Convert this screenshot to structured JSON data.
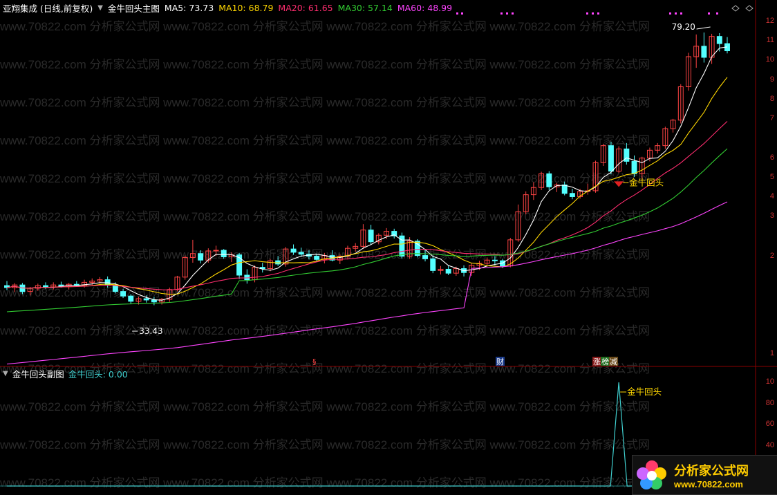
{
  "main_header": {
    "title": "亚翔集成 (日线,前复权)",
    "indicator_name": "金牛回头主图",
    "ma5": "MA5: 73.73",
    "ma10": "MA10: 68.79",
    "ma20": "MA20: 61.65",
    "ma30": "MA30: 57.14",
    "ma60": "MA60: 48.99"
  },
  "sub_header": {
    "title": "金牛回头副图",
    "value": "金牛回头: 0.00"
  },
  "annotations": {
    "high_price": "79.20",
    "low_price": "33.43",
    "signal_label": "金牛回头",
    "sub_signal_label": "金牛回头",
    "event_s": "§",
    "event_cai": "财",
    "event_zhang": "涨",
    "event_bang": "榜",
    "event_jian": "减"
  },
  "watermark": {
    "text": "www.70822.com 分析家公式网"
  },
  "logo": {
    "name": "分析家公式网",
    "url": "www.70822.com"
  },
  "main_axis": [
    "12",
    "11",
    "10",
    "9",
    "8",
    "7",
    "6",
    "5",
    "4",
    "3",
    "2",
    "1"
  ],
  "sub_axis": [
    "10",
    "80",
    "60",
    "40"
  ],
  "colors": {
    "up": "#ff4444",
    "down": "#54ffff",
    "ma5": "#ffffff",
    "ma10": "#ffd700",
    "ma20": "#ff2d6f",
    "ma30": "#32cd32",
    "ma60": "#ff44ff",
    "title_white": "#ffffff",
    "sub_value": "#40d0d0"
  },
  "chart_data": {
    "type": "candlestick",
    "series": [
      {
        "name": "K线",
        "ohlc": [
          [
            40.5,
            41.2,
            39.8,
            40.2
          ],
          [
            40.2,
            40.9,
            39.5,
            40.6
          ],
          [
            40.6,
            40.9,
            39.2,
            39.6
          ],
          [
            39.6,
            40.3,
            39.0,
            40.1
          ],
          [
            40.1,
            40.8,
            39.7,
            40.5
          ],
          [
            40.5,
            41.0,
            40.0,
            40.3
          ],
          [
            40.3,
            41.0,
            39.9,
            40.6
          ],
          [
            40.6,
            41.1,
            40.2,
            40.4
          ],
          [
            40.4,
            40.9,
            39.9,
            40.7
          ],
          [
            40.7,
            41.2,
            40.3,
            40.5
          ],
          [
            40.5,
            41.4,
            40.2,
            41.0
          ],
          [
            41.0,
            41.6,
            40.6,
            41.2
          ],
          [
            41.2,
            41.8,
            40.8,
            41.4
          ],
          [
            41.4,
            41.9,
            40.2,
            40.6
          ],
          [
            40.6,
            41.0,
            39.3,
            39.6
          ],
          [
            39.6,
            40.0,
            38.6,
            38.9
          ],
          [
            38.9,
            39.2,
            37.7,
            38.1
          ],
          [
            38.1,
            38.8,
            37.6,
            38.5
          ],
          [
            38.5,
            39.0,
            37.9,
            38.3
          ],
          [
            38.3,
            38.8,
            37.5,
            38.0
          ],
          [
            38.0,
            38.6,
            37.6,
            38.4
          ],
          [
            38.4,
            40.2,
            38.0,
            39.9
          ],
          [
            39.9,
            42.0,
            39.6,
            41.8
          ],
          [
            41.8,
            45.1,
            41.4,
            44.8
          ],
          [
            44.8,
            47.5,
            44.0,
            45.4
          ],
          [
            45.4,
            45.9,
            43.9,
            44.4
          ],
          [
            44.4,
            46.2,
            44.0,
            45.8
          ],
          [
            45.8,
            46.6,
            45.0,
            45.9
          ],
          [
            45.9,
            46.1,
            44.6,
            44.9
          ],
          [
            44.9,
            45.6,
            44.1,
            45.2
          ],
          [
            45.2,
            45.5,
            41.5,
            42.1
          ],
          [
            42.1,
            43.0,
            40.8,
            41.4
          ],
          [
            41.4,
            43.6,
            41.0,
            43.3
          ],
          [
            43.3,
            44.0,
            42.5,
            43.1
          ],
          [
            43.1,
            44.6,
            42.7,
            44.3
          ],
          [
            44.3,
            45.0,
            43.5,
            43.8
          ],
          [
            43.8,
            46.4,
            43.4,
            46.1
          ],
          [
            46.1,
            46.8,
            45.2,
            45.6
          ],
          [
            45.6,
            46.3,
            44.9,
            45.3
          ],
          [
            45.3,
            45.9,
            44.5,
            45.0
          ],
          [
            45.0,
            45.4,
            44.1,
            44.5
          ],
          [
            44.5,
            45.5,
            43.9,
            45.1
          ],
          [
            45.1,
            45.9,
            44.2,
            44.4
          ],
          [
            44.4,
            45.3,
            43.8,
            45.0
          ],
          [
            45.0,
            46.6,
            44.5,
            46.2
          ],
          [
            46.2,
            47.0,
            45.7,
            46.5
          ],
          [
            46.5,
            49.9,
            46.1,
            49.0
          ],
          [
            49.0,
            49.8,
            46.7,
            47.2
          ],
          [
            47.2,
            48.5,
            46.8,
            48.2
          ],
          [
            48.2,
            49.3,
            47.6,
            48.8
          ],
          [
            48.8,
            49.2,
            47.7,
            48.1
          ],
          [
            48.1,
            48.6,
            44.6,
            45.0
          ],
          [
            45.0,
            47.9,
            44.6,
            47.3
          ],
          [
            47.3,
            47.6,
            44.8,
            45.1
          ],
          [
            45.1,
            46.0,
            44.2,
            44.6
          ],
          [
            44.6,
            45.1,
            42.4,
            42.8
          ],
          [
            42.8,
            43.5,
            42.2,
            43.0
          ],
          [
            43.0,
            43.6,
            42.1,
            42.4
          ],
          [
            42.4,
            43.4,
            42.0,
            43.1
          ],
          [
            43.1,
            43.6,
            41.9,
            42.5
          ],
          [
            42.5,
            43.9,
            42.0,
            43.6
          ],
          [
            43.6,
            44.3,
            42.9,
            43.9
          ],
          [
            43.9,
            44.8,
            43.4,
            44.4
          ],
          [
            44.4,
            45.0,
            43.6,
            44.3
          ],
          [
            44.3,
            44.6,
            43.2,
            43.5
          ],
          [
            43.5,
            47.8,
            43.3,
            47.5
          ],
          [
            47.5,
            52.9,
            47.2,
            51.8
          ],
          [
            51.8,
            54.9,
            51.4,
            54.4
          ],
          [
            54.4,
            56.3,
            53.6,
            55.5
          ],
          [
            55.5,
            57.9,
            55.1,
            57.6
          ],
          [
            57.6,
            58.0,
            55.1,
            55.6
          ],
          [
            55.6,
            56.2,
            54.8,
            55.9
          ],
          [
            55.9,
            56.4,
            54.3,
            54.6
          ],
          [
            54.6,
            55.3,
            53.7,
            54.1
          ],
          [
            54.1,
            55.3,
            53.8,
            54.9
          ],
          [
            54.9,
            56.1,
            54.4,
            55.0
          ],
          [
            55.0,
            59.6,
            54.7,
            59.3
          ],
          [
            59.3,
            62.2,
            58.8,
            61.9
          ],
          [
            61.9,
            62.5,
            57.5,
            58.0
          ],
          [
            58.0,
            61.8,
            57.7,
            61.4
          ],
          [
            61.4,
            62.3,
            59.0,
            59.5
          ],
          [
            59.5,
            60.4,
            57.1,
            57.6
          ],
          [
            57.6,
            60.2,
            56.7,
            60.0
          ],
          [
            60.0,
            61.6,
            59.5,
            61.2
          ],
          [
            61.2,
            62.3,
            60.7,
            61.9
          ],
          [
            61.9,
            64.8,
            61.4,
            64.5
          ],
          [
            64.5,
            66.0,
            63.9,
            65.8
          ],
          [
            65.8,
            71.3,
            65.3,
            70.9
          ],
          [
            70.9,
            76.1,
            70.3,
            75.5
          ],
          [
            75.5,
            78.9,
            73.8,
            77.1
          ],
          [
            77.1,
            79.2,
            74.6,
            75.4
          ],
          [
            75.4,
            79.0,
            74.4,
            78.6
          ],
          [
            78.6,
            79.1,
            76.3,
            77.5
          ],
          [
            77.5,
            78.5,
            76.0,
            76.4
          ]
        ]
      },
      {
        "name": "MA5",
        "value": 73.73
      },
      {
        "name": "MA10",
        "value": 68.79
      },
      {
        "name": "MA20",
        "value": 61.65
      },
      {
        "name": "MA30",
        "value": 57.14
      },
      {
        "name": "MA60",
        "value": 48.99
      }
    ],
    "sub_series": {
      "name": "金牛回头",
      "signal_index": 79,
      "signal_value": 100,
      "current_value": 0.0
    },
    "signal_marker_index": 79,
    "high_marker": {
      "index": 91,
      "value": 79.2
    },
    "low_marker": {
      "index": 16,
      "value": 33.43
    },
    "grid": false
  }
}
